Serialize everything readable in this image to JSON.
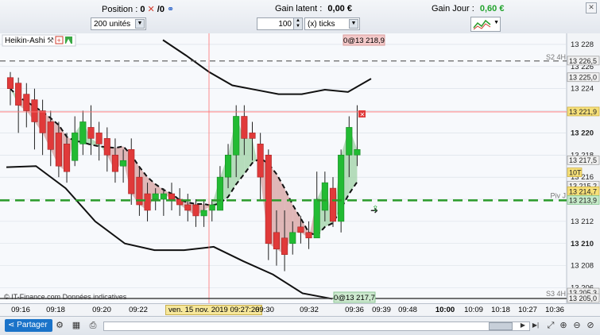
{
  "topbar": {
    "position_label": "Position :",
    "position_value": "0",
    "position_sep": "/",
    "position_value2": "0",
    "latent_label": "Gain latent :",
    "latent_value": "0,00 €",
    "day_label": "Gain Jour :",
    "day_value": "0,60 €",
    "units_select": "200 unités",
    "ticks_value": "100",
    "ticks_select": "(x) ticks"
  },
  "chart": {
    "indicator_label": "Heikin-Ashi",
    "top_order_label": "0@13 218,9",
    "bottom_order_label": "0@13 217,7",
    "watermark": "© IT-Finance.com  Données indicatives",
    "s2_label": "S2 4H",
    "s3_label": "S3 4H",
    "piv_label": "Piv J",
    "tenT_label": "10T",
    "colors": {
      "bull": "#22bb33",
      "bear": "#e03a3a",
      "pivot": "#2a9a2a",
      "grid": "#d7dde5",
      "crosshair": "#ff7070"
    }
  },
  "yaxis": {
    "ticks": [
      "13 228",
      "13 226",
      "13 224",
      "13 222",
      "13 220",
      "13 218",
      "13 216",
      "13 214",
      "13 212",
      "13 210",
      "13 208",
      "13 206"
    ],
    "boxes": [
      "13 226,5",
      "13 225,0",
      "13 221,9",
      "13 217,5",
      "13 215,2",
      "13 214,7",
      "13 213,9",
      "13 205,3",
      "13 205,0"
    ]
  },
  "xaxis": {
    "ticks": [
      "09:16",
      "09:18",
      "09:20",
      "09:22",
      "09:30",
      "09:32",
      "09:36",
      "09:39",
      "09:48",
      "10:00",
      "10:09",
      "10:18",
      "10:27",
      "10:36"
    ],
    "date_label": "ven. 15 nov. 2019 09:27:26"
  },
  "bottombar": {
    "share_label": "Partager"
  },
  "chart_data": {
    "type": "candlestick",
    "ylim": [
      13204.6,
      13229
    ],
    "candles": [
      {
        "o": 13225.0,
        "c": 13224.0,
        "h": 13225.5,
        "l": 13222.5
      },
      {
        "o": 13224.5,
        "c": 13222.5,
        "h": 13225.0,
        "l": 13220.0
      },
      {
        "o": 13223.5,
        "c": 13222.0,
        "h": 13224.5,
        "l": 13220.5
      },
      {
        "o": 13223.0,
        "c": 13221.0,
        "h": 13224.0,
        "l": 13218.5
      },
      {
        "o": 13222.0,
        "c": 13220.0,
        "h": 13223.0,
        "l": 13218.0
      },
      {
        "o": 13221.0,
        "c": 13218.5,
        "h": 13222.0,
        "l": 13217.0
      },
      {
        "o": 13220.0,
        "c": 13217.0,
        "h": 13221.0,
        "l": 13216.0
      },
      {
        "o": 13219.0,
        "c": 13216.5,
        "h": 13220.0,
        "l": 13215.5
      },
      {
        "o": 13217.5,
        "c": 13220.0,
        "h": 13221.5,
        "l": 13217.0
      },
      {
        "o": 13219.0,
        "c": 13221.0,
        "h": 13222.0,
        "l": 13218.0
      },
      {
        "o": 13220.5,
        "c": 13219.5,
        "h": 13222.5,
        "l": 13218.0
      },
      {
        "o": 13220.0,
        "c": 13219.0,
        "h": 13221.0,
        "l": 13217.5
      },
      {
        "o": 13219.5,
        "c": 13218.0,
        "h": 13220.5,
        "l": 13216.5
      },
      {
        "o": 13218.0,
        "c": 13216.5,
        "h": 13219.5,
        "l": 13215.5
      },
      {
        "o": 13217.0,
        "c": 13217.5,
        "h": 13218.5,
        "l": 13215.5
      },
      {
        "o": 13218.5,
        "c": 13214.5,
        "h": 13219.5,
        "l": 13213.5
      },
      {
        "o": 13216.0,
        "c": 13213.5,
        "h": 13217.0,
        "l": 13212.5
      },
      {
        "o": 13214.5,
        "c": 13213.0,
        "h": 13215.5,
        "l": 13212.0
      },
      {
        "o": 13214.0,
        "c": 13214.5,
        "h": 13215.0,
        "l": 13213.0
      },
      {
        "o": 13214.0,
        "c": 13214.5,
        "h": 13215.0,
        "l": 13212.5
      },
      {
        "o": 13214.5,
        "c": 13214.0,
        "h": 13215.5,
        "l": 13213.0
      },
      {
        "o": 13214.0,
        "c": 13213.5,
        "h": 13215.0,
        "l": 13212.5
      },
      {
        "o": 13213.5,
        "c": 13213.0,
        "h": 13214.5,
        "l": 13212.0
      },
      {
        "o": 13213.5,
        "c": 13212.5,
        "h": 13214.0,
        "l": 13211.5
      },
      {
        "o": 13212.5,
        "c": 13213.0,
        "h": 13214.0,
        "l": 13211.5
      },
      {
        "o": 13213.0,
        "c": 13213.5,
        "h": 13214.0,
        "l": 13212.0
      },
      {
        "o": 13213.0,
        "c": 13216.0,
        "h": 13217.0,
        "l": 13213.0
      },
      {
        "o": 13216.0,
        "c": 13218.0,
        "h": 13219.0,
        "l": 13215.0
      },
      {
        "o": 13218.0,
        "c": 13221.5,
        "h": 13222.5,
        "l": 13216.0
      },
      {
        "o": 13221.5,
        "c": 13219.5,
        "h": 13222.5,
        "l": 13218.0
      },
      {
        "o": 13220.0,
        "c": 13219.5,
        "h": 13221.0,
        "l": 13217.5
      },
      {
        "o": 13219.0,
        "c": 13216.0,
        "h": 13220.0,
        "l": 13214.0
      },
      {
        "o": 13218.0,
        "c": 13210.0,
        "h": 13218.5,
        "l": 13208.5
      },
      {
        "o": 13211.0,
        "c": 13209.5,
        "h": 13213.0,
        "l": 13208.0
      },
      {
        "o": 13210.5,
        "c": 13209.0,
        "h": 13213.0,
        "l": 13207.5
      },
      {
        "o": 13210.0,
        "c": 13211.0,
        "h": 13212.0,
        "l": 13209.0
      },
      {
        "o": 13211.5,
        "c": 13211.0,
        "h": 13212.5,
        "l": 13210.0
      },
      {
        "o": 13211.0,
        "c": 13210.5,
        "h": 13212.0,
        "l": 13209.5
      },
      {
        "o": 13210.5,
        "c": 13214.0,
        "h": 13216.5,
        "l": 13210.5
      },
      {
        "o": 13213.0,
        "c": 13215.5,
        "h": 13216.5,
        "l": 13212.0
      },
      {
        "o": 13215.0,
        "c": 13212.0,
        "h": 13216.0,
        "l": 13211.5
      },
      {
        "o": 13212.0,
        "c": 13218.0,
        "h": 13218.5,
        "l": 13211.0
      },
      {
        "o": 13218.0,
        "c": 13220.5,
        "h": 13221.5,
        "l": 13216.0
      },
      {
        "o": 13218.0,
        "c": 13218.5,
        "h": 13222.5,
        "l": 13217.0
      }
    ],
    "upper_band": [
      13228.4,
      13227.0,
      13225.5,
      13224.3,
      13223.9,
      13223.5,
      13223.5,
      13223.9,
      13223.7,
      13224.9
    ],
    "lower_band": [
      13216.9,
      13217.0,
      13215.0,
      13212.0,
      13210.0,
      13209.4,
      13209.4,
      13209.7,
      13208.4,
      13207.2,
      13205.5,
      13205.0
    ],
    "levels": {
      "s2": 13226.5,
      "pivot": 13213.9,
      "crosshair": 13221.9
    }
  }
}
